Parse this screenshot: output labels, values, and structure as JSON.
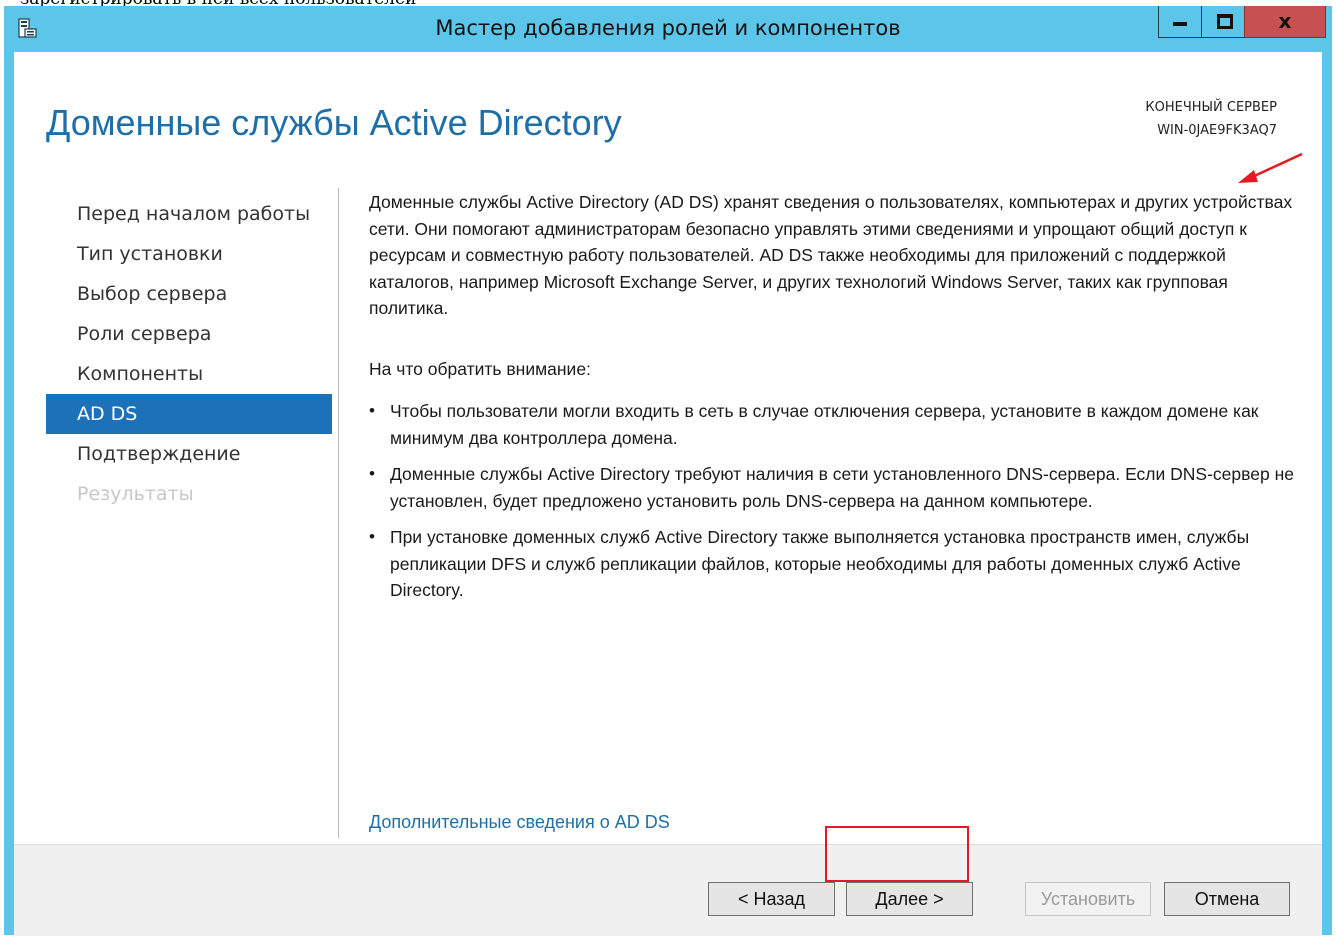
{
  "clipped_top_text": "зарегистрировать в ней всех пользователей",
  "window": {
    "title": "Мастер добавления ролей и компонентов",
    "minimize_label": "_",
    "maximize_label": "□",
    "close_label": "x"
  },
  "header": {
    "page_title": "Доменные службы Active Directory",
    "destination_label": "КОНЕЧНЫЙ СЕРВЕР",
    "destination_server": "WIN-0JAE9FK3AQ7"
  },
  "nav": {
    "items": [
      {
        "label": "Перед началом работы",
        "state": "normal"
      },
      {
        "label": "Тип установки",
        "state": "normal"
      },
      {
        "label": "Выбор сервера",
        "state": "normal"
      },
      {
        "label": "Роли сервера",
        "state": "normal"
      },
      {
        "label": "Компоненты",
        "state": "normal"
      },
      {
        "label": "AD DS",
        "state": "active"
      },
      {
        "label": "Подтверждение",
        "state": "normal"
      },
      {
        "label": "Результаты",
        "state": "disabled"
      }
    ]
  },
  "main": {
    "intro": "Доменные службы Active Directory (AD DS) хранят сведения о пользователях, компьютерах и других устройствах сети.  Они помогают администраторам безопасно управлять этими сведениями и упрощают общий доступ к ресурсам и совместную работу пользователей.  AD DS также необходимы для приложений с поддержкой каталогов, например Microsoft Exchange Server, и других технологий Windows Server, таких как групповая политика.",
    "attention_heading": "На что обратить внимание:",
    "bullets": [
      "Чтобы пользователи могли входить в сеть в случае отключения сервера, установите в каждом домене как минимум два контроллера домена.",
      "Доменные службы Active Directory требуют наличия в сети установленного DNS-сервера.  Если DNS-сервер не установлен, будет предложено установить роль DNS-сервера на данном компьютере.",
      "При установке доменных служб Active Directory также выполняется установка пространств имен, службы репликации DFS и служб репликации файлов, которые необходимы для работы доменных служб Active Directory."
    ],
    "more_info_link": "Дополнительные сведения о AD DS"
  },
  "footer": {
    "back_label": "< Назад",
    "next_label": "Далее >",
    "install_label": "Установить",
    "cancel_label": "Отмена"
  },
  "colors": {
    "titlebar": "#5bc6ea",
    "accent": "#1c71b8",
    "title_text": "#1e6fa8",
    "annotation": "#e01b24"
  }
}
